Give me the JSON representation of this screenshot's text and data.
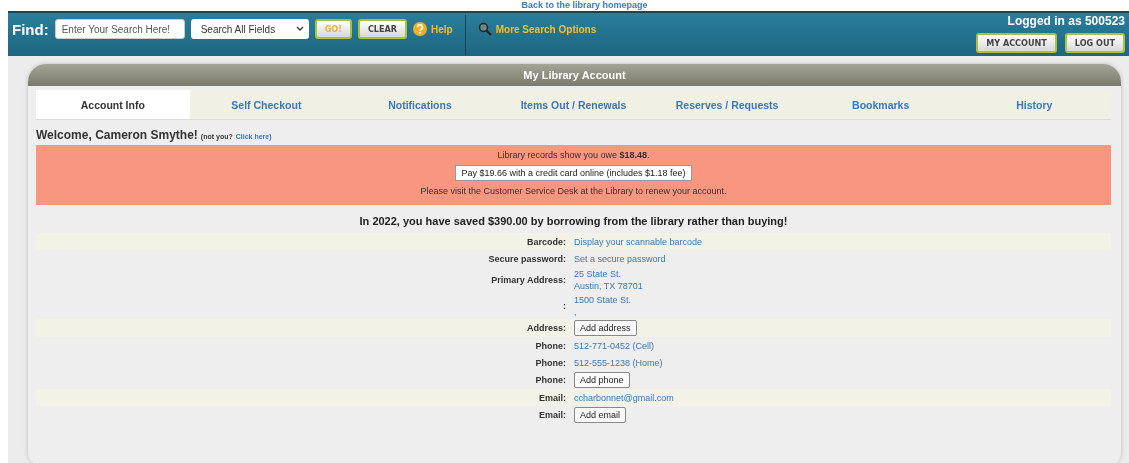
{
  "top_link": "Back to the library homepage",
  "header": {
    "find_label": "Find:",
    "search": {
      "placeholder": "Enter Your Search Here!"
    },
    "field_select": "Search All Fields",
    "go": "GO!",
    "clear": "CLEAR",
    "help": "Help",
    "more": "More Search Options",
    "logged_in": "Logged in as 500523",
    "my_account": "MY ACCOUNT",
    "log_out": "LOG OUT"
  },
  "panel": {
    "title": "My Library Account",
    "tabs": [
      {
        "label": "Account Info",
        "selected": true
      },
      {
        "label": "Self Checkout",
        "selected": false
      },
      {
        "label": "Notifications",
        "selected": false
      },
      {
        "label": "Items Out / Renewals",
        "selected": false
      },
      {
        "label": "Reserves / Requests",
        "selected": false
      },
      {
        "label": "Bookmarks",
        "selected": false
      },
      {
        "label": "History",
        "selected": false
      }
    ],
    "welcome": "Welcome, Cameron Smythe!",
    "not_you": "(not you?",
    "click_here": "Click here)",
    "alert": {
      "owe": "Library records show you owe **$18.48**.",
      "pay_button": "Pay $19.66 with a credit card online (includes $1.18 fee)",
      "note": "Please visit the Customer Service Desk at the Library to renew your account."
    },
    "savings": "In 2022, you have saved $390.00 by borrowing from the library rather than buying!",
    "rows": [
      {
        "label": "Barcode:",
        "kind": "link",
        "values": [
          "Display your scannable barcode"
        ]
      },
      {
        "label": "Secure password:",
        "kind": "link",
        "values": [
          "Set a secure password"
        ]
      },
      {
        "label": "Primary Address:",
        "kind": "text",
        "values": [
          "25 State St.",
          "Austin, TX  78701"
        ]
      },
      {
        "label": ":",
        "kind": "text",
        "values": [
          "1500 State St.",
          ","
        ]
      },
      {
        "label": "Address:",
        "kind": "button",
        "values": [
          "Add address"
        ]
      },
      {
        "label": "Phone:",
        "kind": "text",
        "values": [
          "512-771-0452 (Cell)"
        ]
      },
      {
        "label": "Phone:",
        "kind": "text",
        "values": [
          "512-555-1238 (Home)"
        ]
      },
      {
        "label": "Phone:",
        "kind": "button",
        "values": [
          "Add phone"
        ]
      },
      {
        "label": "Email:",
        "kind": "text",
        "values": [
          "ccharbonnet@gmail.com"
        ]
      },
      {
        "label": "Email:",
        "kind": "button",
        "values": [
          "Add email"
        ]
      }
    ]
  }
}
